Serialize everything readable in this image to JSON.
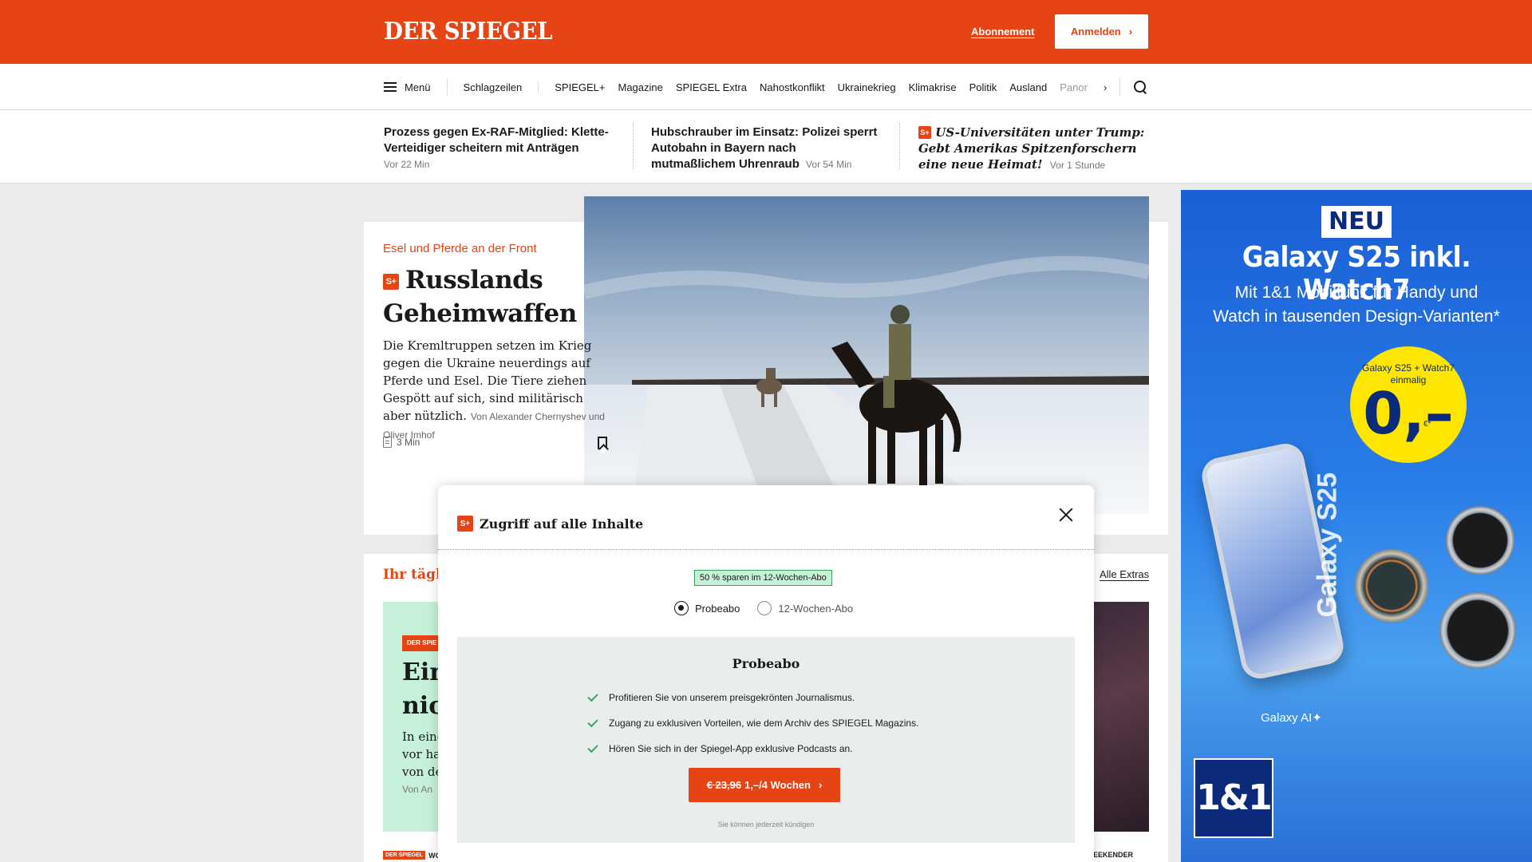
{
  "header": {
    "logo": "DER SPIEGEL",
    "subscription_link": "Abonnement",
    "login_button": "Anmelden"
  },
  "nav": {
    "menu_label": "Menü",
    "items": [
      "Schlagzeilen",
      "SPIEGEL+",
      "Magazine",
      "SPIEGEL Extra",
      "Nahostkonflikt",
      "Ukrainekrieg",
      "Klimakrise",
      "Politik",
      "Ausland",
      "Panor"
    ],
    "more_icon": "chevron-right-icon",
    "search_icon": "search-icon"
  },
  "ticker": [
    {
      "title": "Prozess gegen Ex-RAF-Mitglied: Klette-Verteidiger scheitern mit Anträgen",
      "time": "Vor 22 Min",
      "plus": false
    },
    {
      "title": "Hubschrauber im Einsatz: Polizei sperrt Autobahn in Bayern nach mutmaßlichem Uhrenraub",
      "time": "Vor 54 Min",
      "plus": false
    },
    {
      "title": "US-Universitäten unter Trump: Gebt Amerikas Spitzenforschern eine neue Heimat!",
      "time": "Vor 1 Stunde",
      "plus": true
    }
  ],
  "lead_article": {
    "kicker": "Esel und Pferde an der Front",
    "headline": "Russlands Geheimwaffen",
    "teaser": "Die Kremltruppen setzen im Krieg gegen die Ukraine neuerdings auf Pferde und Esel. Die Tiere ziehen Gespött auf sich, sind militärisch aber nützlich.",
    "author": "Von Alexander Chernyshev und Oliver Imhof",
    "read_time": "3 Min",
    "plus_badge": "S+"
  },
  "section": {
    "title": "Ihr täglic",
    "all_link": "Alle Extras",
    "green_logo": "DER SPIE",
    "green_headline_1": "Ein",
    "green_headline_2": "nic",
    "green_text_1": "In eine",
    "green_text_2": "vor ha",
    "green_text_3": "von de",
    "green_author": "Von An",
    "footer_left_logo": "DER SPIEGEL",
    "footer_left": "WORK",
    "footer_right": "EEKENDER"
  },
  "modal": {
    "title": "Zugriff auf alle Inhalte",
    "plus_badge": "S+",
    "save_badge": "50 % sparen im 12-Wochen-Abo",
    "options": [
      "Probeabo",
      "12-Wochen-Abo"
    ],
    "selected": "Probeabo",
    "plan_title": "Probeabo",
    "benefits": [
      "Profitieren Sie von unserem preisgekrönten Journalismus.",
      "Zugang zu exklusiven Vorteilen, wie dem Archiv des SPIEGEL Magazins.",
      "Hören Sie sich in der Spiegel-App exklusive Podcasts an."
    ],
    "cta_old_price": "€ 23,96",
    "cta_new_price": "1,–/4 Wochen",
    "cancel_note": "Sie können jederzeit kündigen"
  },
  "ad": {
    "badge": "NEU",
    "title": "Galaxy S25 inkl. Watch7",
    "subtitle": "Mit 1&1 Mobilfunk für Handy und Watch in tausenden Design-Varianten*",
    "circle_text": "Galaxy S25 + Watch7 einmalig",
    "price": "0,–",
    "currency": "€*",
    "phone_label": "Galaxy S25",
    "ai_label": "Galaxy AI✦",
    "brand": "1&1"
  },
  "colors": {
    "brand": "#e64415",
    "green": "#3aa55d",
    "ad_blue": "#1a5fd6",
    "ad_yellow": "#ffe600"
  }
}
